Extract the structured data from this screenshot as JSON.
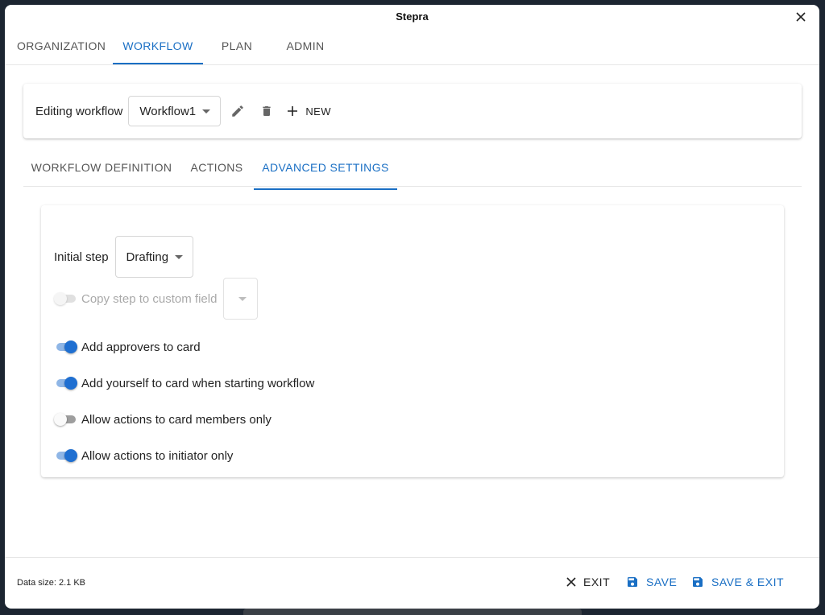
{
  "window": {
    "title": "Stepra"
  },
  "top_tabs": [
    {
      "label": "ORGANIZATION"
    },
    {
      "label": "WORKFLOW",
      "active": true
    },
    {
      "label": "PLAN"
    },
    {
      "label": "ADMIN"
    }
  ],
  "editor": {
    "label": "Editing workflow",
    "workflow_select": "Workflow1",
    "icons": [
      "pencil-icon",
      "trash-icon",
      "plus-icon"
    ],
    "new_label": "NEW"
  },
  "sub_tabs": [
    {
      "label": "WORKFLOW DEFINITION"
    },
    {
      "label": "ACTIONS"
    },
    {
      "label": "ADVANCED SETTINGS",
      "active": true
    }
  ],
  "settings": {
    "initial_step_label": "Initial step",
    "initial_step_value": "Drafting",
    "copy_step": {
      "label": "Copy step to custom field",
      "enabled": false,
      "disabled": true,
      "field_value": ""
    },
    "toggles": [
      {
        "label": "Add approvers to card",
        "on": true
      },
      {
        "label": "Add yourself to card when starting workflow",
        "on": true
      },
      {
        "label": "Allow actions to card members only",
        "on": false
      },
      {
        "label": "Allow actions to initiator only",
        "on": true
      }
    ]
  },
  "footer": {
    "data_size": "Data size: 2.1 KB",
    "exit_label": "EXIT",
    "save_label": "SAVE",
    "save_exit_label": "SAVE & EXIT"
  },
  "colors": {
    "accent": "#1a6fc4",
    "toggle_on": "#1f6fd1",
    "backdrop": "#1c2531"
  }
}
